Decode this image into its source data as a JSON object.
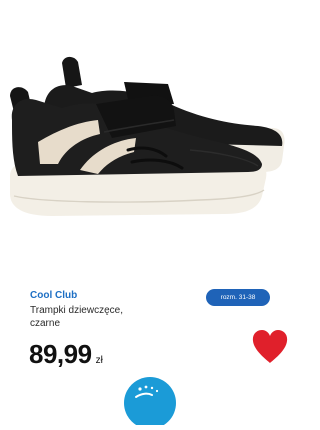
{
  "product": {
    "brand": "Cool Club",
    "name": "Trampki dziewczęce, czarne",
    "size_badge": "rozm. 31-38",
    "price_value": "89,99",
    "price_currency": "zł"
  },
  "colors": {
    "brand_text": "#1d6fc4",
    "badge_bg": "#1f63b8",
    "heart": "#e0202b",
    "bottom_badge": "#1b9bd7"
  },
  "icons": {
    "wishlist": "heart-icon",
    "bottom_badge": "promo-badge-icon"
  }
}
